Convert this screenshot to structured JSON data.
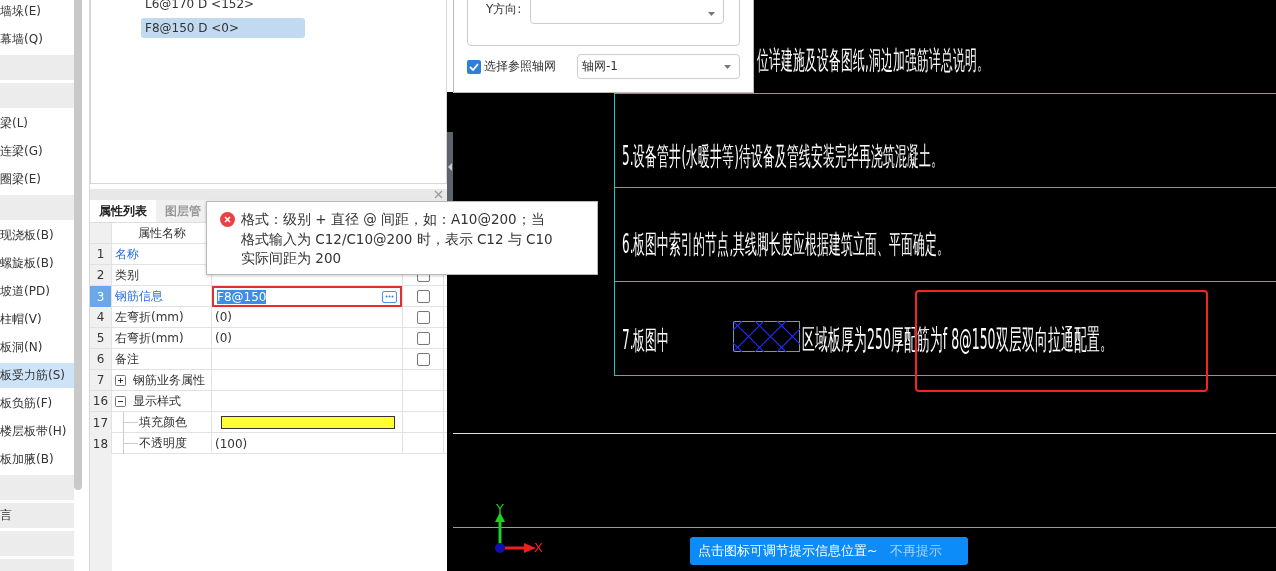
{
  "sidebar": {
    "items": [
      {
        "kind": "item",
        "label": "墙垛(E)",
        "selected": false
      },
      {
        "kind": "item",
        "label": "幕墙(Q)",
        "selected": false
      },
      {
        "kind": "group",
        "selected": false
      },
      {
        "kind": "group",
        "selected": false
      },
      {
        "kind": "item",
        "label": "梁(L)",
        "selected": false
      },
      {
        "kind": "item",
        "label": "连梁(G)",
        "selected": false
      },
      {
        "kind": "item",
        "label": "圈梁(E)",
        "selected": false
      },
      {
        "kind": "group",
        "selected": false
      },
      {
        "kind": "item",
        "label": "现浇板(B)",
        "selected": false
      },
      {
        "kind": "item",
        "label": "螺旋板(B)",
        "selected": false
      },
      {
        "kind": "item",
        "label": "坡道(PD)",
        "selected": false
      },
      {
        "kind": "item",
        "label": "柱帽(V)",
        "selected": false
      },
      {
        "kind": "item",
        "label": "板洞(N)",
        "selected": false
      },
      {
        "kind": "item",
        "label": "板受力筋(S)",
        "selected": true
      },
      {
        "kind": "item",
        "label": "板负筋(F)",
        "selected": false
      },
      {
        "kind": "item",
        "label": "楼层板带(H)",
        "selected": false
      },
      {
        "kind": "item",
        "label": "板加腋(B)",
        "selected": false
      },
      {
        "kind": "group",
        "selected": false
      },
      {
        "kind": "group",
        "label": "言",
        "selected": false
      },
      {
        "kind": "group",
        "selected": false
      },
      {
        "kind": "group",
        "selected": false
      }
    ]
  },
  "rebar_list": {
    "items": [
      {
        "label": "L6@170 D <152>",
        "selected": false
      },
      {
        "label": "F8@150 D <0>",
        "selected": true
      }
    ]
  },
  "properties": {
    "tabs": [
      {
        "label": "属性列表",
        "selected": true
      },
      {
        "label": "图层管",
        "selected": false
      }
    ],
    "header": "属性名称",
    "rows": [
      {
        "index": "1",
        "kind": "text",
        "name": "名称",
        "emphasized": true,
        "selected": false
      },
      {
        "index": "2",
        "kind": "text",
        "name": "类别",
        "emphasized": false,
        "selected": false,
        "checkbox": {
          "checked": false
        }
      },
      {
        "index": "3",
        "kind": "edit",
        "name": "钢筋信息",
        "value": "F8@150",
        "emphasized": true,
        "selected": true,
        "checkbox": {
          "checked": false
        }
      },
      {
        "index": "4",
        "kind": "text",
        "name": "左弯折(mm)",
        "value": "(0)",
        "emphasized": false,
        "selected": false,
        "checkbox": {
          "checked": false
        }
      },
      {
        "index": "5",
        "kind": "text",
        "name": "右弯折(mm)",
        "value": "(0)",
        "emphasized": false,
        "selected": false,
        "checkbox": {
          "checked": false
        }
      },
      {
        "index": "6",
        "kind": "text",
        "name": "备注",
        "emphasized": false,
        "selected": false,
        "checkbox": {
          "checked": false
        }
      },
      {
        "index": "7",
        "kind": "group",
        "name": "钢筋业务属性",
        "expanded": false,
        "emphasized": false,
        "selected": false
      },
      {
        "index": "16",
        "kind": "group",
        "name": "显示样式",
        "expanded": true,
        "emphasized": false,
        "selected": false,
        "children": [
          {
            "index": "17",
            "kind": "color",
            "name": "填充颜色",
            "color": "#ffff33",
            "emphasized": false,
            "selected": false
          },
          {
            "index": "18",
            "kind": "text",
            "name": "不透明度",
            "value": "(100)",
            "emphasized": false,
            "selected": false
          }
        ]
      }
    ]
  },
  "error_tooltip": {
    "lines": [
      "格式：级别 + 直径 @ 间距，如：A10@200；当",
      "格式输入为 C12/C10@200 时，表示 C12 与 C10",
      "实际间距为 200"
    ]
  },
  "grid_dialog": {
    "y_direction_label": "Y方向:",
    "reference_grid": {
      "label": "选择参照轴网",
      "checked": true,
      "value": "轴网-1"
    }
  },
  "drawing": {
    "notes": [
      {
        "kind": "line",
        "text": "位详建施及设备图纸,洞边加强筋详总说明。"
      },
      {
        "kind": "line",
        "text": "5.设备管井(水暖井等)待设备及管线安装完毕再浇筑混凝土。"
      },
      {
        "kind": "line",
        "text": "6.板图中索引的节点,其线脚长度应根据建筑立面、平面确定。"
      },
      {
        "kind": "hatched",
        "prefix": "7.板图中",
        "text": "区域板厚为250厚配筋为f 8@150双层双向拉通配置。"
      }
    ],
    "axis": {
      "x": "X",
      "y": "Y"
    }
  },
  "hint_bar": {
    "message": "点击图标可调节提示信息位置~",
    "dismiss": "不再提示"
  }
}
